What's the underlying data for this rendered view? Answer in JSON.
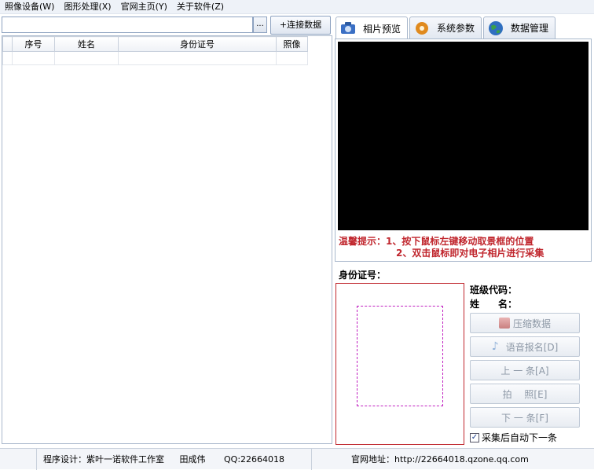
{
  "menu": [
    "照像设备(W)",
    "图形处理(X)",
    "官网主页(Y)",
    "关于软件(Z)"
  ],
  "toolbar": {
    "path_value": "",
    "browse_label": "...",
    "connect_label": "+连接数据"
  },
  "grid": {
    "columns": [
      "序号",
      "姓名",
      "身份证号",
      "照像"
    ]
  },
  "tabs": [
    {
      "label": "相片预览",
      "icon": "camera-icon",
      "color": "#3a6fc4"
    },
    {
      "label": "系统参数",
      "icon": "settings-icon",
      "color": "#e08a1e"
    },
    {
      "label": "数据管理",
      "icon": "globe-icon",
      "color": "#2a8a3a"
    }
  ],
  "preview": {
    "tip_line1": "温馨提示：1、按下鼠标左键移动取景框的位置",
    "tip_line2": "2、双击鼠标即对电子相片进行采集"
  },
  "form": {
    "id_label": "身份证号：",
    "class_label": "班级代码：",
    "name_label": "姓　　名："
  },
  "buttons": {
    "compress": "压缩数据",
    "voice": "语音报名[D]",
    "prev": "上 一 条[A]",
    "shoot": "拍　 照[E]",
    "next": "下 一 条[F]"
  },
  "auto_next_label": "采集后自动下一条",
  "auto_next_checked": "✓",
  "status": {
    "designer": "程序设计：紫叶一诺软件工作室",
    "author": "田成伟",
    "qq": "QQ:22664018",
    "site": "官网地址：http://22664018.qzone.qq.com"
  },
  "colors": {
    "accent_red": "#c0262d",
    "disabled_text": "#8d98a6",
    "frame_dash": "#c020c0"
  }
}
